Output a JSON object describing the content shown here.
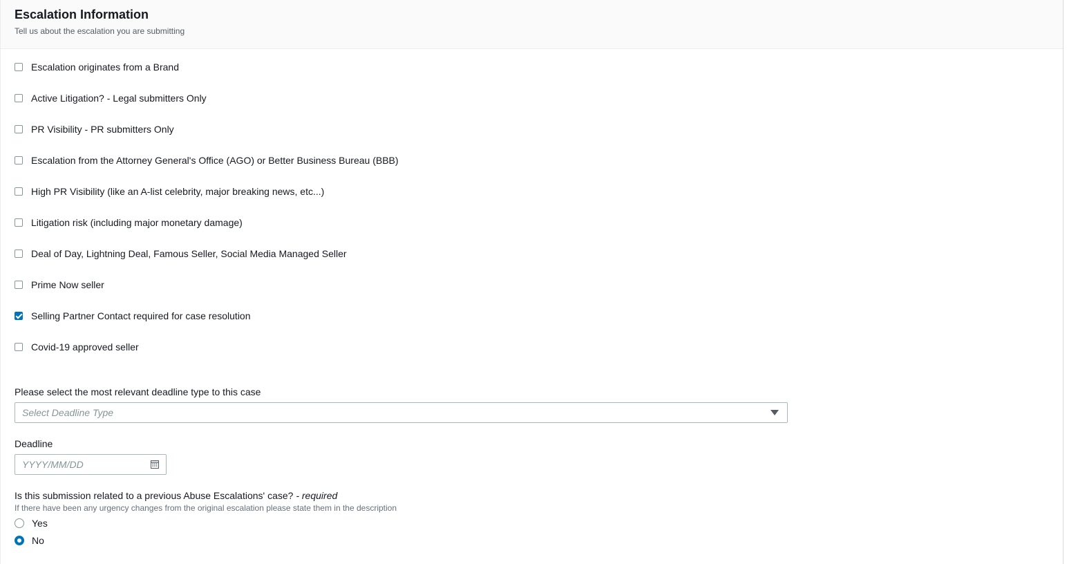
{
  "header": {
    "title": "Escalation Information",
    "subtitle": "Tell us about the escalation you are submitting"
  },
  "checkboxes": [
    {
      "label": "Escalation originates from a Brand",
      "checked": false
    },
    {
      "label": "Active Litigation? - Legal submitters Only",
      "checked": false
    },
    {
      "label": "PR Visibility - PR submitters Only",
      "checked": false
    },
    {
      "label": "Escalation from the Attorney General's Office (AGO) or Better Business Bureau (BBB)",
      "checked": false
    },
    {
      "label": "High PR Visibility (like an A-list celebrity, major breaking news, etc...)",
      "checked": false
    },
    {
      "label": "Litigation risk (including major monetary damage)",
      "checked": false
    },
    {
      "label": "Deal of Day, Lightning Deal, Famous Seller, Social Media Managed Seller",
      "checked": false
    },
    {
      "label": "Prime Now seller",
      "checked": false
    },
    {
      "label": "Selling Partner Contact required for case resolution",
      "checked": true
    },
    {
      "label": "Covid-19 approved seller",
      "checked": false
    }
  ],
  "deadline_type": {
    "label": "Please select the most relevant deadline type to this case",
    "placeholder": "Select Deadline Type"
  },
  "deadline": {
    "label": "Deadline",
    "placeholder": "YYYY/MM/DD"
  },
  "previous_case": {
    "question": "Is this submission related to a previous Abuse Escalations' case?",
    "required_suffix": "- required",
    "hint": "If there have been any urgency changes from the original escalation please state them in the description",
    "options": [
      {
        "label": "Yes",
        "selected": false
      },
      {
        "label": "No",
        "selected": true
      }
    ]
  },
  "colors": {
    "accent": "#0073bb",
    "border": "#aab7b8",
    "text": "#16191f",
    "muted": "#545b64"
  }
}
